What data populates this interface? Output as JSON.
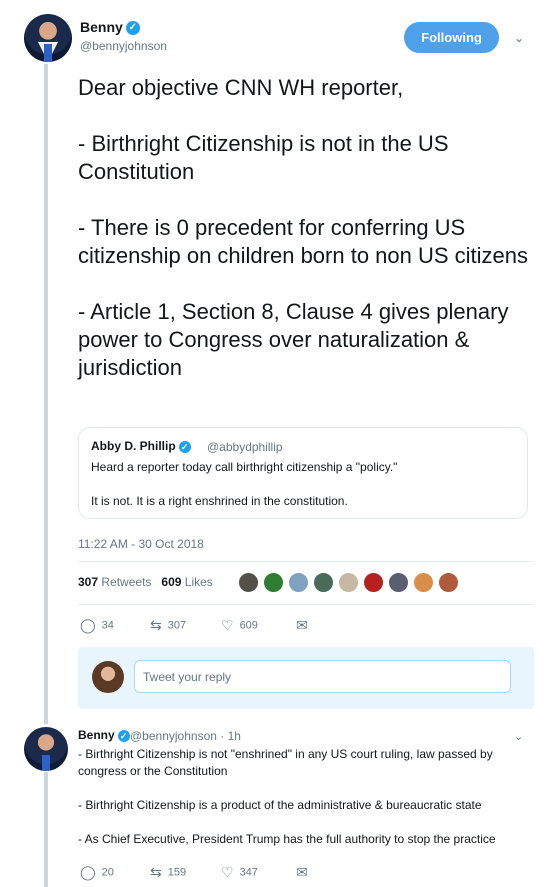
{
  "tweet": {
    "author": {
      "name": "Benny",
      "handle": "@bennyjohnson"
    },
    "follow_label": "Following",
    "paragraphs": [
      "Dear objective CNN WH reporter,",
      "- Birthright Citizenship is not in the US Constitution",
      "- There is 0 precedent for conferring US citizenship on children born to non US citizens",
      "- Article 1, Section 8, Clause 4 gives plenary power to Congress over naturalization & jurisdiction"
    ],
    "quote": {
      "name": "Abby D. Phillip",
      "handle": "@abbydphillip",
      "line1": "Heard a reporter today call birthright citizenship a \"policy.\"",
      "line2": "It is not. It is a right enshrined in the constitution."
    },
    "timestamp": "11:22 AM - 30 Oct 2018",
    "stats": {
      "retweets_count": "307",
      "retweets_label": "Retweets",
      "likes_count": "609",
      "likes_label": "Likes"
    },
    "actions": {
      "replies": "34",
      "retweets": "307",
      "likes": "609"
    }
  },
  "reply_box": {
    "placeholder": "Tweet your reply"
  },
  "reply": {
    "name": "Benny",
    "handle": "@bennyjohnson · 1h",
    "paragraphs": [
      "- Birthright Citizenship is not \"enshrined\" in any US court ruling, law passed by congress or the Constitution",
      "- Birthright Citizenship is a product of the administrative & bureaucratic state",
      "- As Chief Executive, President Trump has the full authority to stop the practice"
    ],
    "actions": {
      "replies": "20",
      "retweets": "159",
      "likes": "347"
    }
  },
  "colors": {
    "accent": "#1da1f2",
    "follow_button": "#4ea1e8",
    "reply_box_bg": "#e8f5fd",
    "thread_line": "#ccd6dd"
  },
  "icons": [
    "verified-icon",
    "caret-down-icon",
    "reply-icon",
    "retweet-icon",
    "like-icon",
    "message-icon"
  ]
}
